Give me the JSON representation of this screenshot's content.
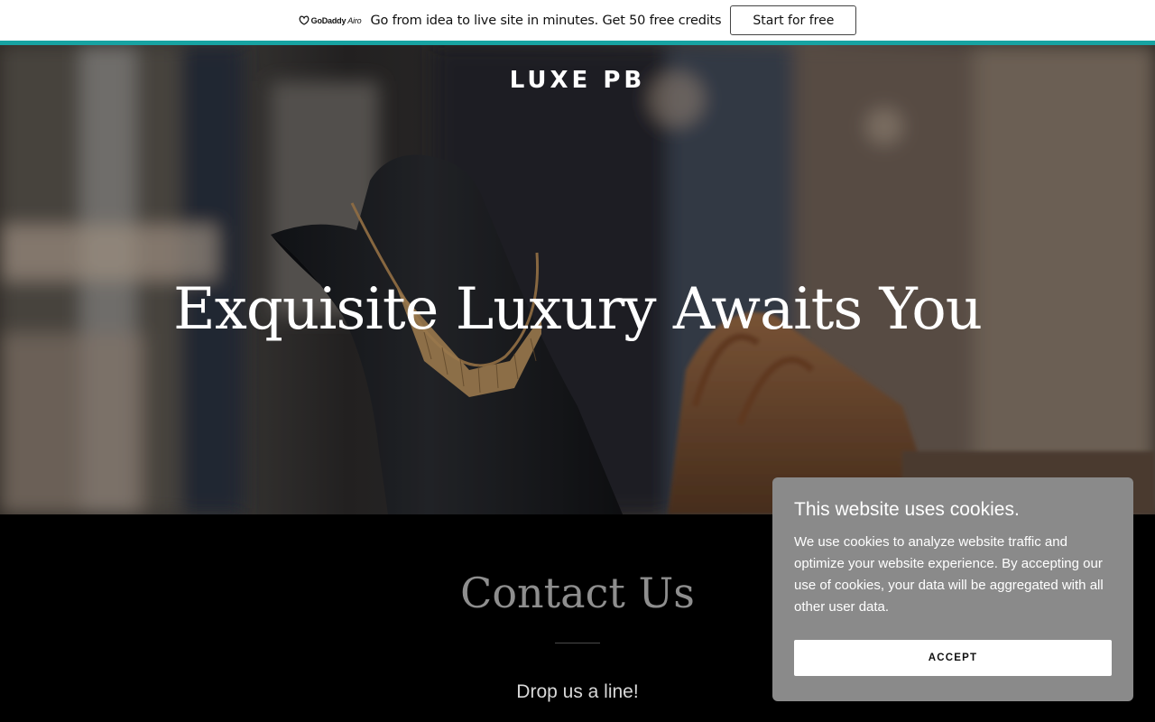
{
  "promo": {
    "brand": "GoDaddy",
    "brand_suffix": "Airo",
    "text": "Go from idea to live site in minutes. Get 50 free credits",
    "button_label": "Start for free",
    "accent_color": "#17a3a2"
  },
  "hero": {
    "site_name": "LUXE PB",
    "title": "Exquisite Luxury Awaits You",
    "image_subject": "necklace-on-black-bust"
  },
  "contact": {
    "title": "Contact Us",
    "subtitle": "Drop us a line!"
  },
  "cookie_banner": {
    "title": "This website uses cookies.",
    "body": "We use cookies to analyze website traffic and optimize your website experience. By accepting our use of cookies, your data will be aggregated with all other user data.",
    "accept_label": "ACCEPT"
  }
}
